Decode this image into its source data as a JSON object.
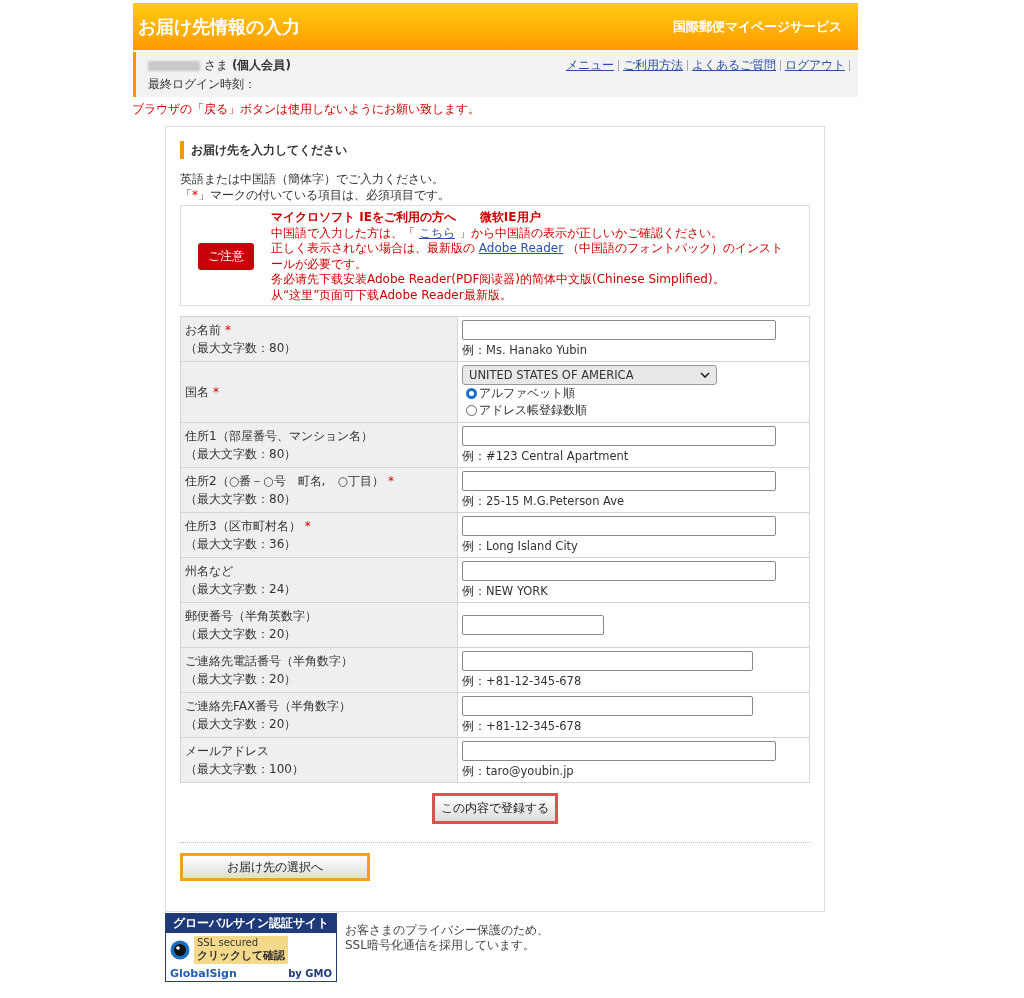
{
  "header": {
    "title": "お届け先情報の入力",
    "service": "国際郵便マイページサービス"
  },
  "user_bar": {
    "honorific": "さま",
    "member_type": "(個人会員)",
    "last_login_label": "最終ログイン時刻：",
    "links": [
      "メニュー",
      "ご利用方法",
      "よくあるご質問",
      "ログアウト"
    ]
  },
  "warning": "ブラウザの「戻る」ボタンは使用しないようにお願い致します。",
  "section": {
    "heading": "お届け先を入力してください",
    "intro": "英語または中国語（簡体字）でご入力ください。",
    "required_note_parts": [
      "「",
      "*",
      "」マークの付いている項目は、必須項目です。"
    ]
  },
  "notice": {
    "badge": "ご注意",
    "title": "マイクロソフト IEをご利用の方へ　　微软IE用户",
    "paragraphs": [
      [
        {
          "text": "中国語で入力した方は、「 "
        },
        {
          "text": "こちら",
          "link": true
        },
        {
          "text": " 」から中国語の表示が正しいかご確認ください。"
        }
      ],
      [
        {
          "text": "正しく表示されない場合は、最新版の "
        },
        {
          "text": "Adobe Reader",
          "link": true
        },
        {
          "text": " （中国語のフォントパック）のインストールが必要です。"
        }
      ],
      [
        {
          "text": "务必请先下载安装Adobe Reader(PDF阅读器)的简体中文版(Chinese Simplified)。"
        }
      ],
      [
        {
          "text": "从“这里”页面可下载Adobe Reader最新版。"
        }
      ]
    ]
  },
  "form": [
    {
      "label": "お名前",
      "max": "（最大文字数：80）",
      "required": true,
      "kind": "long",
      "example": "例：Ms. Hanako Yubin"
    },
    {
      "label": "国名",
      "required": true,
      "kind": "select",
      "value": "UNITED STATES OF AMERICA",
      "options": [
        {
          "label": "アルファベット順",
          "selected": true
        },
        {
          "label": "アドレス帳登録数順",
          "selected": false
        }
      ]
    },
    {
      "label": "住所1（部屋番号、マンション名）",
      "max": "（最大文字数：80）",
      "required": false,
      "kind": "long",
      "example": "例：#123 Central Apartment"
    },
    {
      "label": "住所2（○番－○号　町名,　○丁目）",
      "max": "（最大文字数：80）",
      "required": true,
      "kind": "long",
      "example": "例：25-15 M.G.Peterson Ave"
    },
    {
      "label": "住所3（区市町村名）",
      "max": "（最大文字数：36）",
      "required": true,
      "kind": "long",
      "example": "例：Long Island City"
    },
    {
      "label": "州名など",
      "max": "（最大文字数：24）",
      "required": false,
      "kind": "long",
      "example": "例：NEW YORK"
    },
    {
      "label": "郵便番号（半角英数字）",
      "max": "（最大文字数：20）",
      "required": false,
      "kind": "short"
    },
    {
      "label": "ご連絡先電話番号（半角数字）",
      "max": "（最大文字数：20）",
      "required": false,
      "kind": "medium",
      "example": "例：+81-12-345-678"
    },
    {
      "label": "ご連絡先FAX番号（半角数字）",
      "max": "（最大文字数：20）",
      "required": false,
      "kind": "medium",
      "example": "例：+81-12-345-678"
    },
    {
      "label": "メールアドレス",
      "max": "（最大文字数：100）",
      "required": false,
      "kind": "long",
      "example": "例：taro@youbin.jp"
    }
  ],
  "submit_button": "この内容で登録する",
  "back_button": "お届け先の選択へ",
  "ssl_badge": {
    "top": "グローバルサイン認証サイト",
    "secured": "SSL secured",
    "check": "クリックして確認",
    "brand": "GlobalSign",
    "by": "by GMO"
  },
  "footer_note": [
    "お客さまのプライバシー保護のため、",
    "SSL暗号化通信を採用しています。"
  ]
}
